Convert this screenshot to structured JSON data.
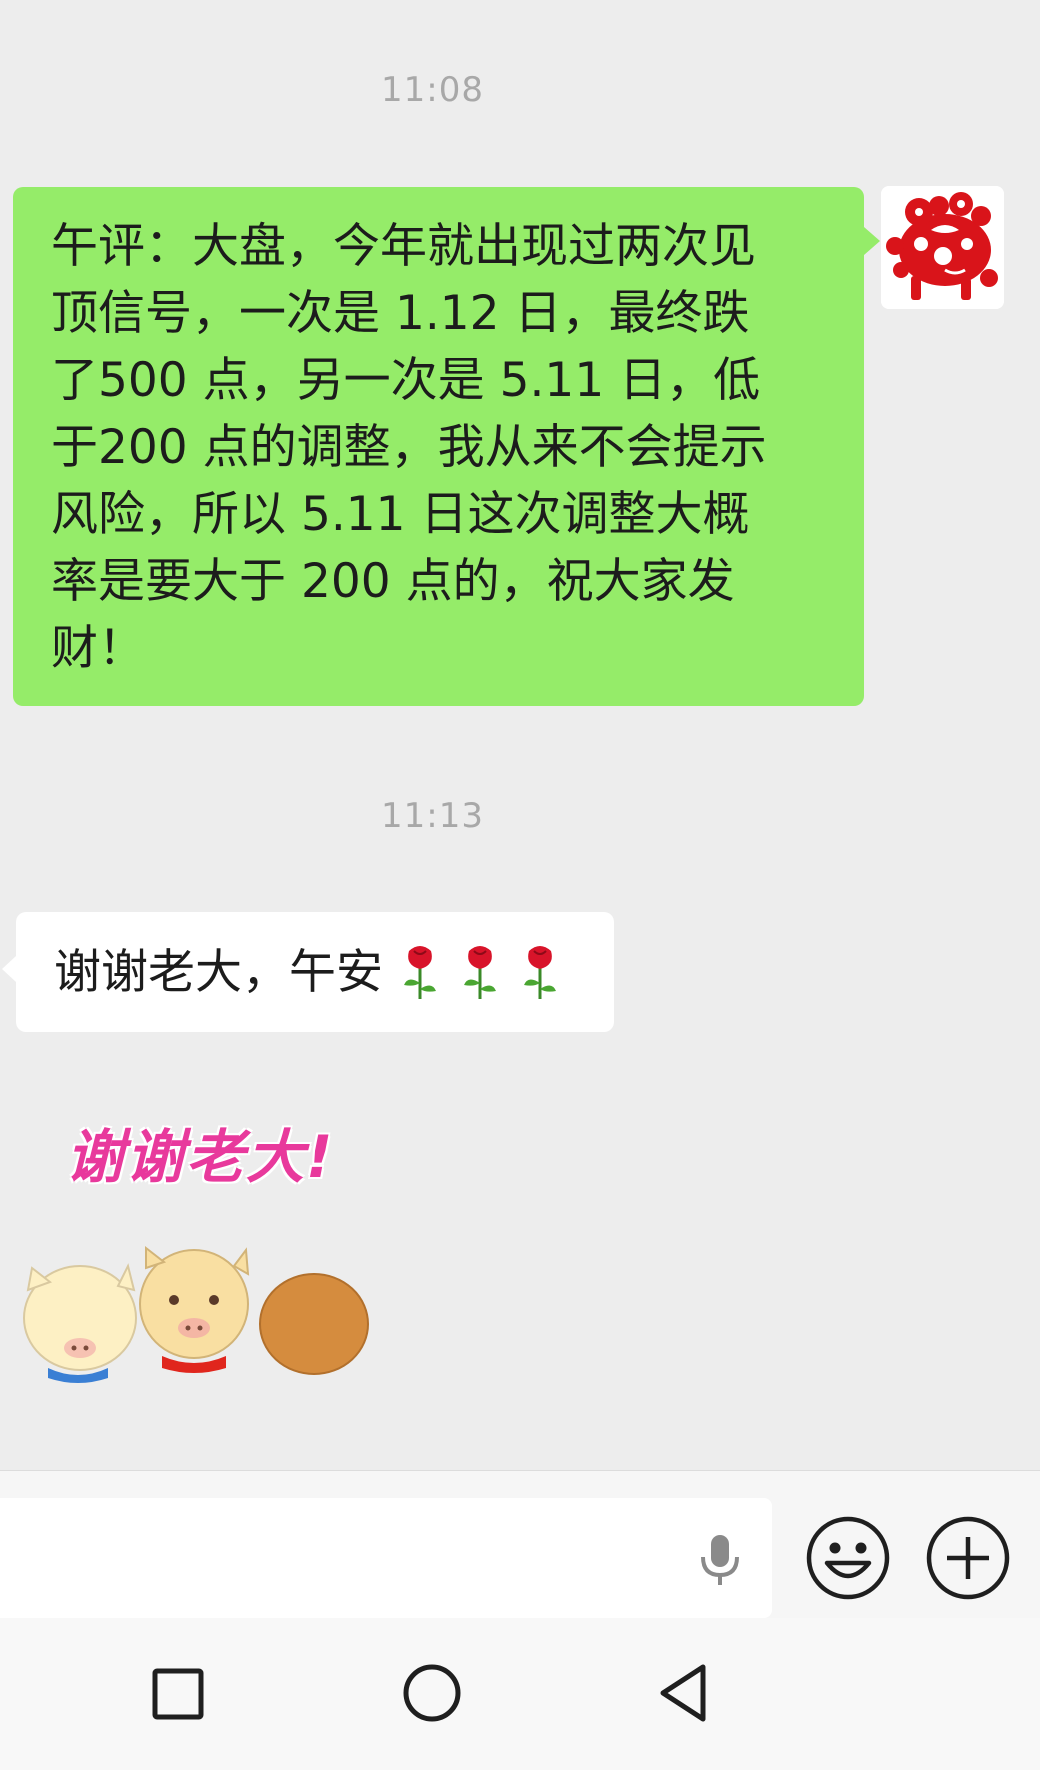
{
  "chat": {
    "messages": [
      {
        "timestamp": "11:08",
        "sender": "self",
        "type": "text",
        "lines": [
          "午评：大盘，今年就出现过两次见",
          "顶信号，一次是 1.12 日，最终跌",
          "了500 点，另一次是 5.11 日，低",
          "于200 点的调整，我从来不会提示",
          "风险，所以 5.11 日这次调整大概",
          "率是要大于 200 点的，祝大家发",
          "财！"
        ]
      },
      {
        "timestamp": "11:13",
        "sender": "other",
        "type": "text",
        "text": "谢谢老大，午安",
        "emoji": [
          "rose-icon",
          "rose-icon",
          "rose-icon"
        ]
      },
      {
        "sender": "other",
        "type": "sticker",
        "caption": "谢谢老大!"
      }
    ]
  },
  "colors": {
    "background": "#ededed",
    "outgoing_bubble": "#95ec69",
    "incoming_bubble": "#ffffff",
    "timestamp": "#a8a8a8",
    "avatar_red": "#d9141a"
  },
  "input_bar": {
    "placeholder": "",
    "icons": [
      "voice-icon",
      "emoji-icon",
      "add-icon"
    ]
  },
  "nav_bar": {
    "icons": [
      "recent-apps-icon",
      "home-icon",
      "back-icon"
    ]
  }
}
